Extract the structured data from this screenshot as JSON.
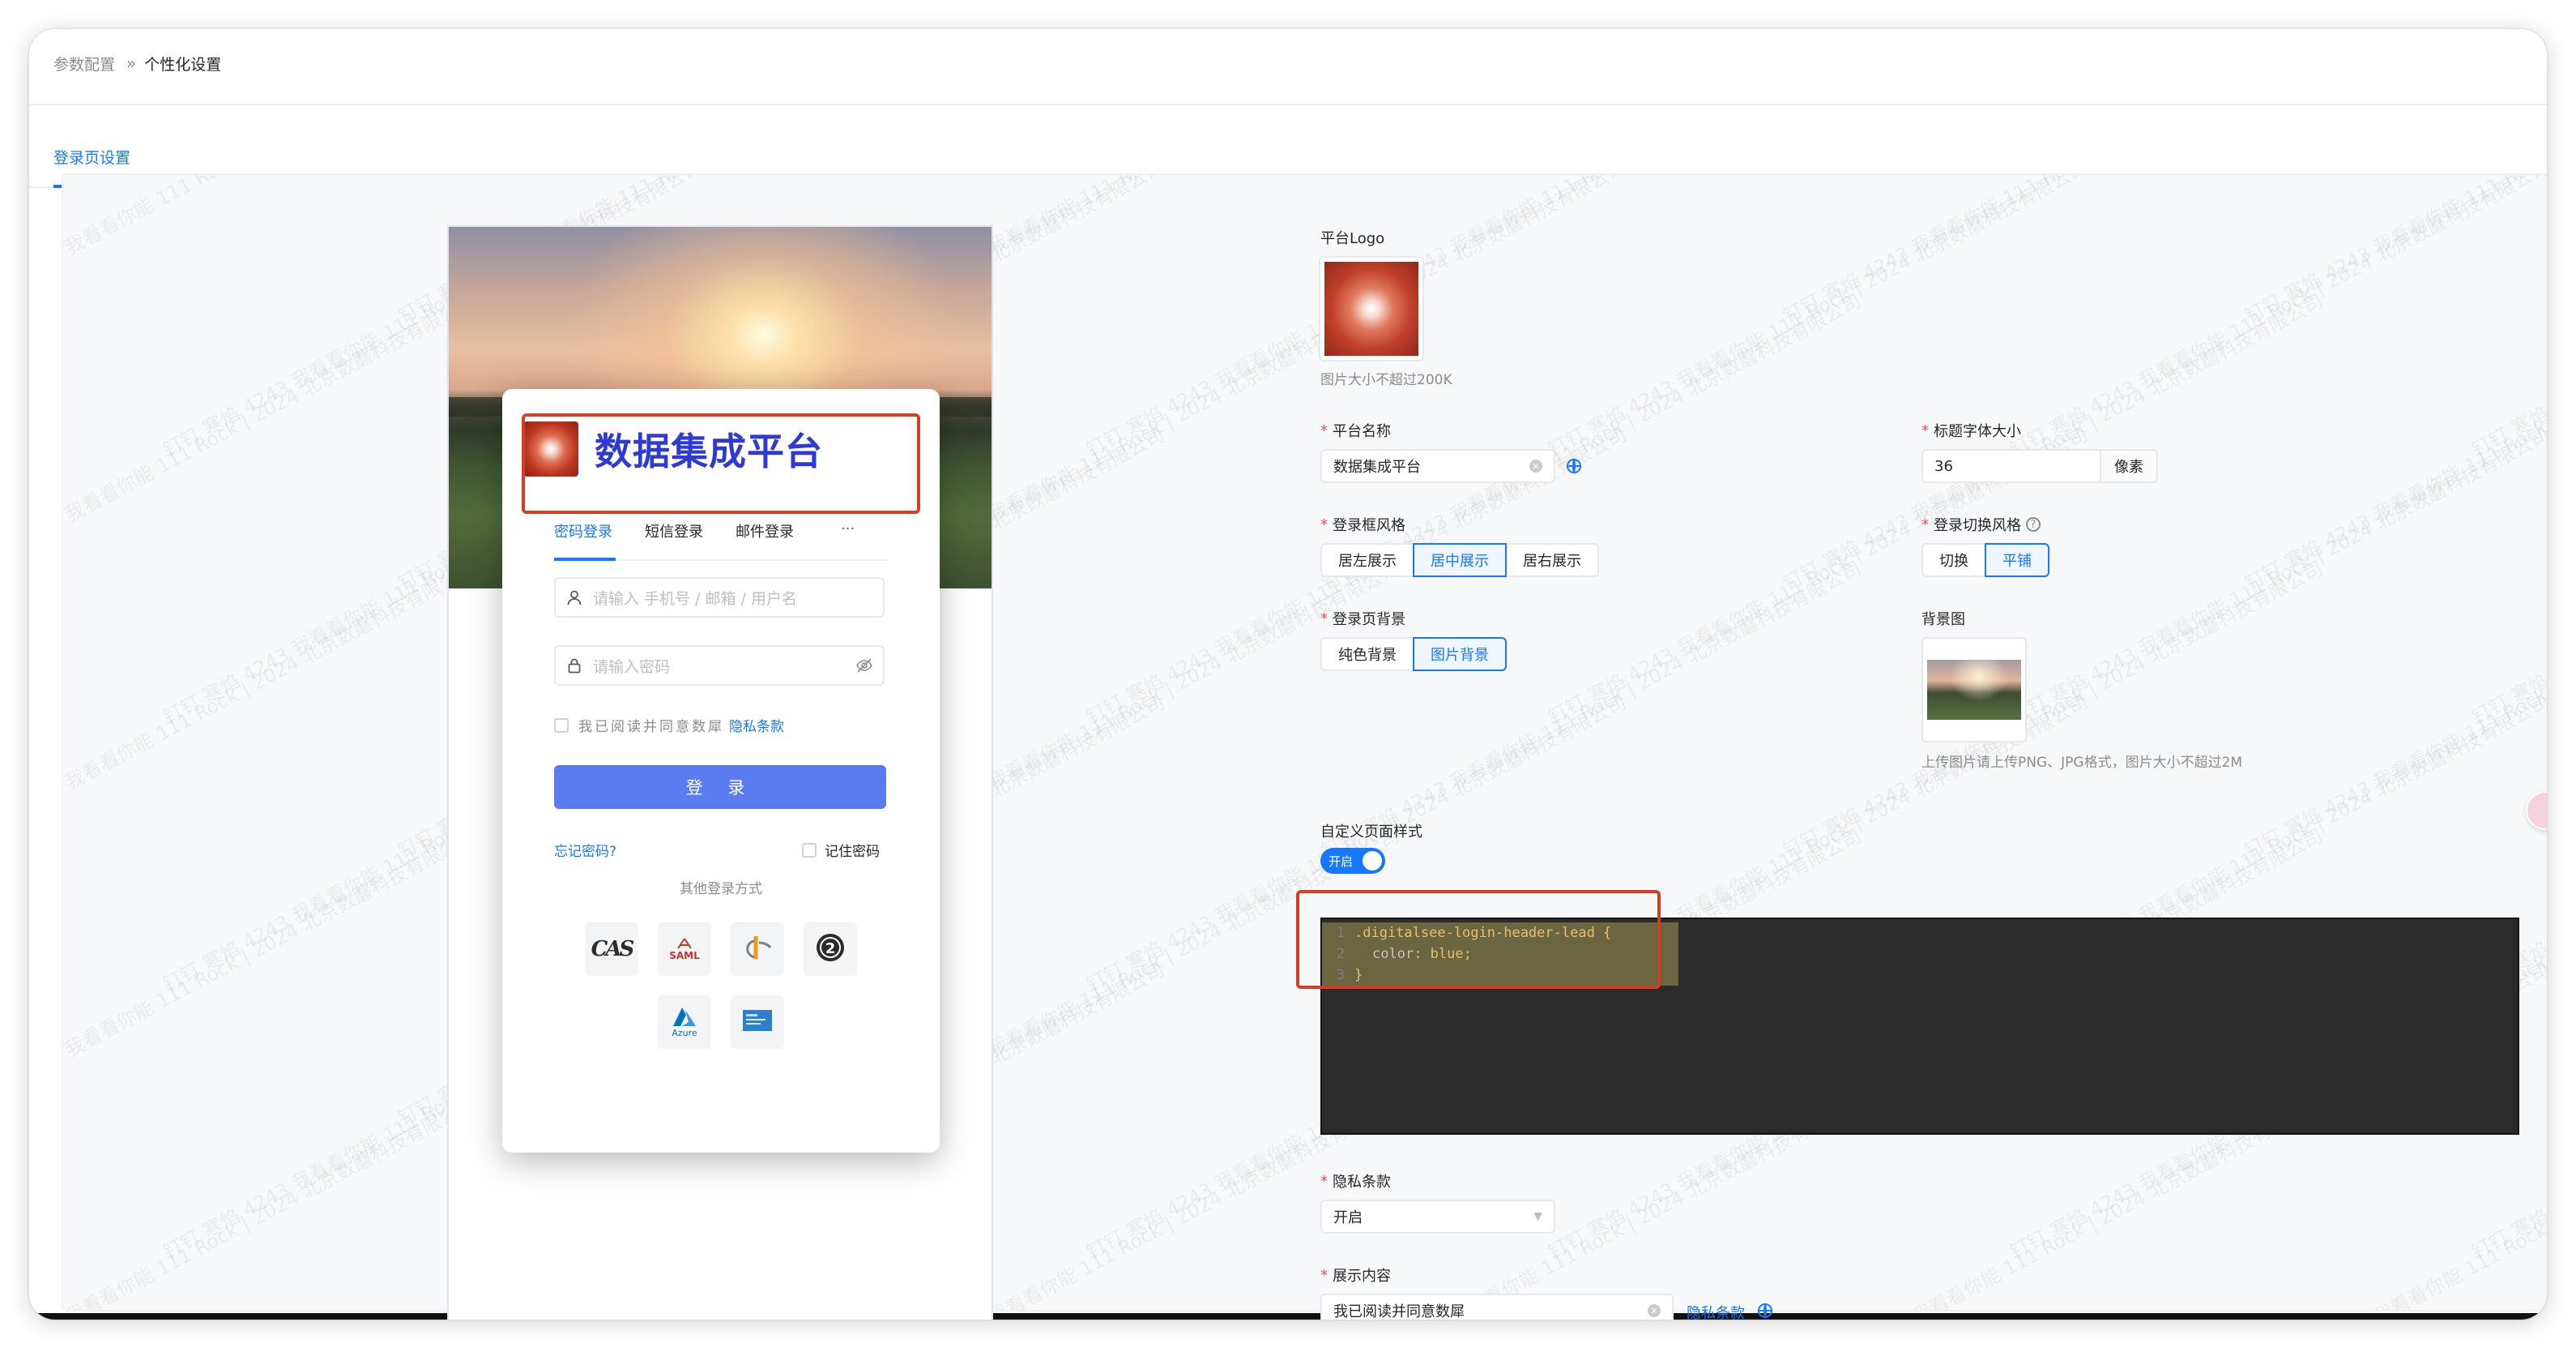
{
  "breadcrumb": {
    "root": "参数配置",
    "separator": "»",
    "current": "个性化设置"
  },
  "tabs": [
    {
      "label": "登录页设置",
      "active": true
    }
  ],
  "watermark": "钉钉 寒焰 4243 我看看你能 111 Rock | 2024 北京数蘑科技有限公司",
  "preview": {
    "brand_title": "数据集成平台",
    "login_tabs": [
      "密码登录",
      "短信登录",
      "邮件登录",
      "···"
    ],
    "account_placeholder": "请输入 手机号 / 邮箱 / 用户名",
    "password_placeholder": "请输入密码",
    "agree_text": "我已阅读并同意数犀",
    "privacy_link": "隐私条款",
    "login_button": "登 录",
    "forgot_password": "忘记密码?",
    "remember_password": "记住密码",
    "other_login_title": "其他登录方式",
    "sso_providers": [
      "CAS",
      "SAML",
      "OpenID",
      "OAuth2",
      "Azure",
      "Microsoft"
    ],
    "sso_labels": {
      "cas": "CAS",
      "saml": "SAML",
      "azure": "Azure"
    }
  },
  "form": {
    "logo": {
      "label": "平台Logo",
      "hint": "图片大小不超过200K"
    },
    "platform_name": {
      "label": "平台名称",
      "value": "数据集成平台"
    },
    "title_font_size": {
      "label": "标题字体大小",
      "value": "36",
      "unit": "像素"
    },
    "login_box_style": {
      "label": "登录框风格",
      "options": [
        "居左展示",
        "居中展示",
        "居右展示"
      ],
      "selected": "居中展示"
    },
    "login_switch_style": {
      "label": "登录切换风格",
      "options": [
        "切换",
        "平铺"
      ],
      "selected": "平铺"
    },
    "login_background": {
      "label": "登录页背景",
      "options": [
        "纯色背景",
        "图片背景"
      ],
      "selected": "图片背景"
    },
    "background_image": {
      "label": "背景图",
      "hint": "上传图片请上传PNG、JPG格式，图片大小不超过2M"
    },
    "custom_style": {
      "label": "自定义页面样式",
      "toggle_label": "开启",
      "enabled": true,
      "code": [
        {
          "num": "1",
          "selector": ".digitalsee-login-header-lead {"
        },
        {
          "num": "2",
          "prop": "color",
          "value": "blue;"
        },
        {
          "num": "3",
          "brace": "}"
        }
      ]
    },
    "privacy_policy": {
      "label": "隐私条款",
      "value": "开启"
    },
    "display_content": {
      "label": "展示内容",
      "value": "我已阅读并同意数犀",
      "link": "隐私条款"
    }
  },
  "colors": {
    "accent": "#1677ff",
    "login_button": "#5b7cf0",
    "brand_title": "#2f3ad6",
    "highlight": "#d14026",
    "editor_bg": "#2b2b2b"
  }
}
